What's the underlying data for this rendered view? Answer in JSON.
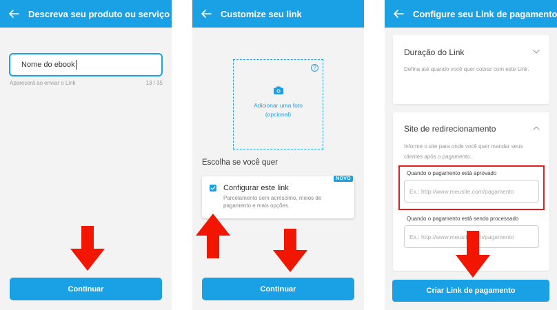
{
  "colors": {
    "primary": "#1aa1e5",
    "arrow_red": "#f21500",
    "highlight_red": "#e02020",
    "screen_bg": "#f3f3f3"
  },
  "screen1": {
    "title": "Descreva seu produto ou serviço",
    "input_value": "Nome do ebook",
    "hint": "Aparecerá ao enviar o Link",
    "counter": "13 / 35",
    "continue_label": "Continuar"
  },
  "screen2": {
    "title": "Customize seu link",
    "photo_line1": "Adicionar uma foto",
    "photo_line2": "(opcional)",
    "help_symbol": "?",
    "choose_title": "Escolha se você quer",
    "config_title": "Configurar este link",
    "config_desc": "Parcelamento sem acréscimo, meios de pagamento e mais opções.",
    "config_checked": true,
    "new_badge": "NOVO",
    "continue_label": "Continuar"
  },
  "screen3": {
    "title": "Configure seu Link de pagamento",
    "duration_title": "Duração do Link",
    "duration_desc": "Defina até quando você quer cobrar com este Link.",
    "redirect_title": "Site de redirecionamento",
    "redirect_desc": "Informe o site para onde você quer mandar seus clientes após o pagamento.",
    "approved_label": "Quando o pagamento está aprovado",
    "approved_placeholder": "Ex.: http://www.meusite.com/pagamento",
    "processing_label": "Quando o pagamento está sendo processado",
    "processing_placeholder": "Ex.: http://www.meusite.com/pagamento",
    "create_label": "Criar Link de pagamento"
  },
  "icons": {
    "back": "back-arrow-icon",
    "camera": "camera-icon",
    "help": "help-icon",
    "check": "check-icon",
    "chevron_down": "chevron-down-icon",
    "chevron_up": "chevron-up-icon",
    "annotation_arrow": "red-arrow-icon"
  }
}
